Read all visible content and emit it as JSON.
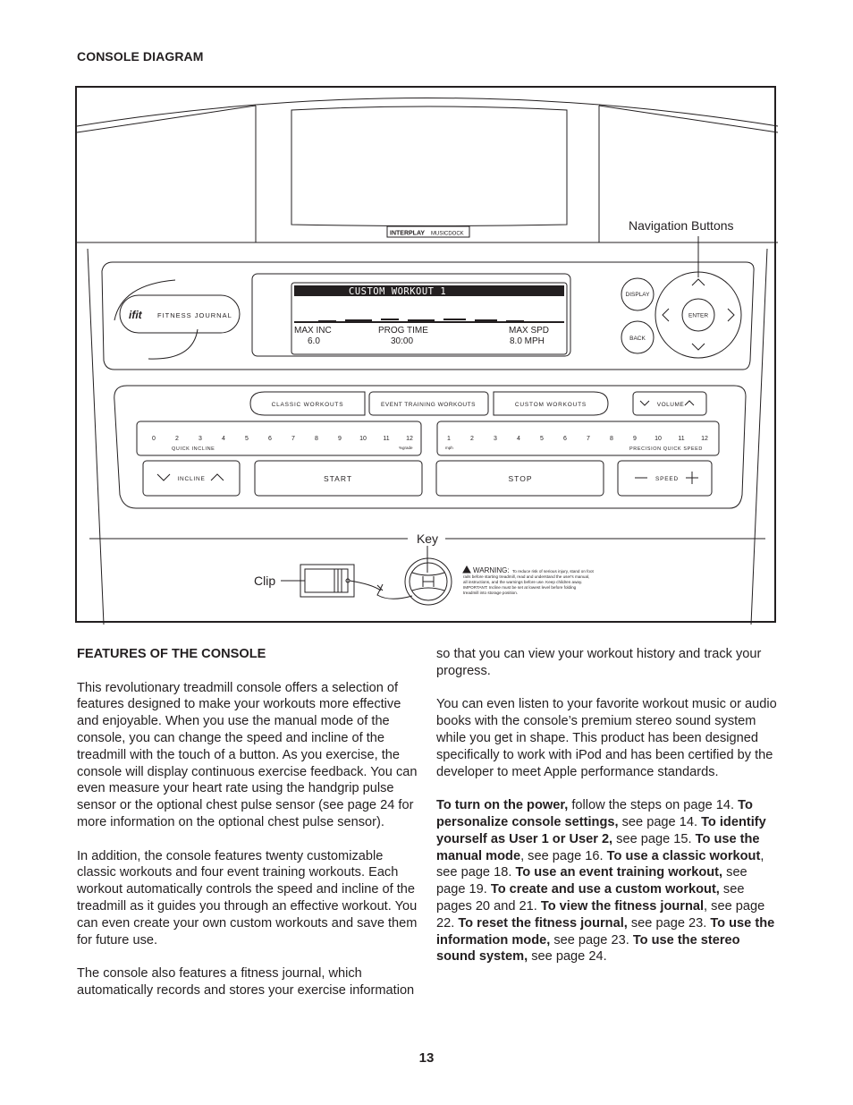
{
  "page": {
    "title": "CONSOLE DIAGRAM",
    "page_number": "13"
  },
  "diagram": {
    "dock_label_bold": "INTERPLAY",
    "dock_label_light": "MUSICDOCK",
    "fitness_journal": {
      "logo": "ifit",
      "label": "FITNESS JOURNAL"
    },
    "lcd": {
      "title": "CUSTOM WORKOUT 1",
      "fields": [
        {
          "label": "MAX INC",
          "value": "6.0"
        },
        {
          "label": "PROG TIME",
          "value": "30:00"
        },
        {
          "label": "MAX SPD",
          "value": "8.0 MPH"
        }
      ]
    },
    "nav": {
      "display": "DISPLAY",
      "back": "BACK",
      "enter": "ENTER"
    },
    "workout_buttons": [
      "CLASSIC WORKOUTS",
      "EVENT TRAINING WORKOUTS",
      "CUSTOM WORKOUTS"
    ],
    "volume_label": "VOLUME",
    "incline_keys": [
      "0",
      "2",
      "3",
      "4",
      "5",
      "6",
      "7",
      "8",
      "9",
      "10",
      "11",
      "12"
    ],
    "incline_caption": "QUICK INCLINE",
    "incline_unit": "%grade",
    "speed_keys": [
      "1",
      "2",
      "3",
      "4",
      "5",
      "6",
      "7",
      "8",
      "9",
      "10",
      "11",
      "12"
    ],
    "speed_caption": "PRECISION QUICK SPEED",
    "speed_unit": "mph",
    "incline_label": "INCLINE",
    "start_label": "START",
    "stop_label": "STOP",
    "speed_label": "SPEED",
    "callouts": {
      "navigation": "Navigation Buttons",
      "key": "Key",
      "clip": "Clip"
    },
    "warning": {
      "heading": "WARNING:",
      "lines": [
        "To reduce risk of serious injury, stand on foot",
        "rails before starting treadmill, read and understand the user's manual,",
        "all instructions, and the warnings before use.  Keep children away.",
        "IMPORTANT: Incline must be set at lowest level before folding",
        "treadmill into storage position."
      ]
    }
  },
  "features": {
    "heading": "FEATURES OF THE CONSOLE",
    "paragraphs": [
      "This revolutionary treadmill console offers a selection of features designed to make your workouts more effective and enjoyable. When you use the manual mode of the console, you can change the speed and incline of the treadmill with the touch of a button. As you exercise, the console will display continuous exercise feedback. You can even measure your heart rate using the handgrip pulse sensor or the optional chest pulse sensor (see page 24 for more information on the optional chest pulse sensor).",
      "In addition, the console features twenty customizable classic workouts and four event training workouts. Each workout automatically controls the speed and incline of the treadmill as it guides you through an effective workout. You can even create your own custom workouts and save them for future use.",
      "The console also features a fitness journal, which automatically records and stores your exercise information so that you can view your workout history and track your progress.",
      "You can even listen to your favorite workout music or audio books with the console’s premium stereo sound system while you get in shape. This product has been designed specifically to work with iPod and has been certified by the developer to meet Apple performance standards."
    ],
    "instructions": [
      {
        "bold": "To turn on the power,",
        "text": " follow the steps on page 14. "
      },
      {
        "bold": "To personalize console settings,",
        "text": " see page 14. "
      },
      {
        "bold": "To identify yourself as User 1 or User 2,",
        "text": " see page 15. "
      },
      {
        "bold": "To use the manual mode",
        "text": ", see page 16. "
      },
      {
        "bold": "To use a classic workout",
        "text": ", see page 18. "
      },
      {
        "bold": "To use an event training workout,",
        "text": " see page 19. "
      },
      {
        "bold": "To create and use a custom workout,",
        "text": " see pages 20 and 21. "
      },
      {
        "bold": "To view the fitness journal",
        "text": ", see page 22. "
      },
      {
        "bold": "To reset the fitness journal,",
        "text": " see page 23. "
      },
      {
        "bold": "To use the information mode,",
        "text": " see page 23. "
      },
      {
        "bold": "To use the stereo sound system,",
        "text": " see page 24."
      }
    ]
  }
}
